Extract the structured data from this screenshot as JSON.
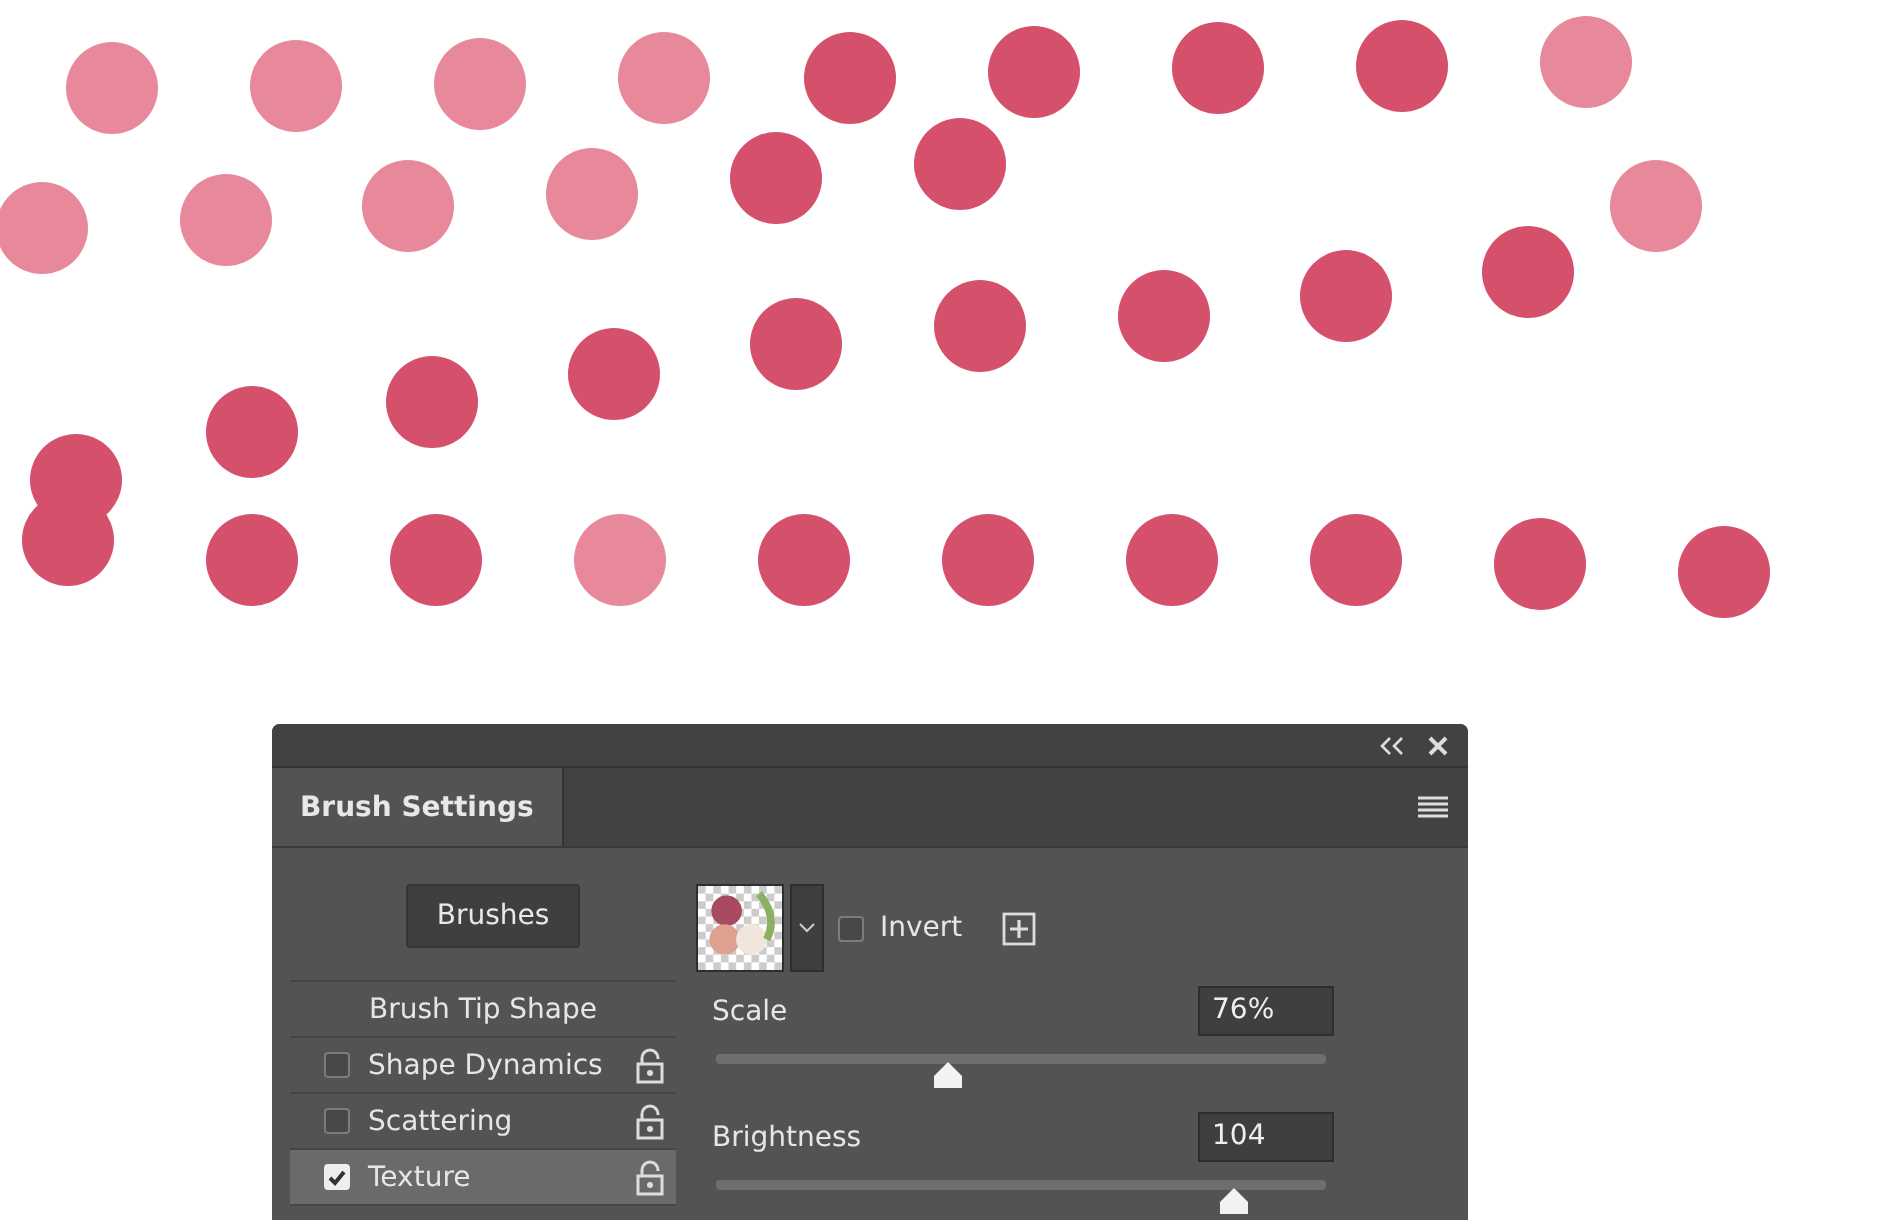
{
  "panel": {
    "tabs": [
      {
        "label": "Brush Settings",
        "selected": true
      }
    ],
    "brushes_button": "Brushes",
    "items": [
      {
        "kind": "heading",
        "label": "Brush Tip Shape",
        "selected": false
      },
      {
        "kind": "option",
        "label": "Shape Dynamics",
        "checked": false,
        "selected": false,
        "locked": false
      },
      {
        "kind": "option",
        "label": "Scattering",
        "checked": false,
        "selected": false,
        "locked": false
      },
      {
        "kind": "option",
        "label": "Texture",
        "checked": true,
        "selected": true,
        "locked": false
      }
    ],
    "invert": {
      "label": "Invert",
      "checked": false
    },
    "sliders": [
      {
        "label": "Scale",
        "reading": "76%",
        "level": 0.38
      },
      {
        "label": "Brightness",
        "reading": "104",
        "level": 0.85
      }
    ]
  }
}
